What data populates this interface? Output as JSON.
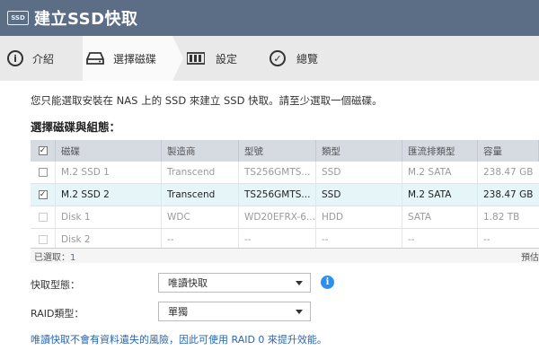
{
  "window": {
    "title": "建立SSD快取",
    "icon_text": "SSD",
    "icon": "ssd-icon"
  },
  "steps": [
    {
      "label": "介紹",
      "icon": "info-circle-icon",
      "active": false
    },
    {
      "label": "選擇磁碟",
      "icon": "disk-drive-icon",
      "active": true
    },
    {
      "label": "設定",
      "icon": "settings-bars-icon",
      "active": false
    },
    {
      "label": "總覽",
      "icon": "check-circle-icon",
      "active": false
    }
  ],
  "description": "您只能選取安裝在 NAS 上的 SSD 來建立 SSD 快取。請至少選取一個磁碟。",
  "section_title": "選擇磁碟與組態：",
  "table": {
    "columns": [
      "磁碟",
      "製造商",
      "型號",
      "類型",
      "匯流排類型",
      "容量"
    ],
    "rows": [
      {
        "checked": false,
        "enabled": true,
        "cells": [
          "M.2 SSD 1",
          "Transcend",
          "TS256GMTS...",
          "SSD",
          "M.2 SATA",
          "238.47 GB"
        ]
      },
      {
        "checked": true,
        "enabled": true,
        "cells": [
          "M.2 SSD 2",
          "Transcend",
          "TS256GMTS...",
          "SSD",
          "M.2 SATA",
          "238.47 GB"
        ]
      },
      {
        "checked": false,
        "enabled": false,
        "cells": [
          "Disk 1",
          "WDC",
          "WD20EFRX-6...",
          "HDD",
          "SATA",
          "1.82 TB"
        ]
      },
      {
        "checked": false,
        "enabled": false,
        "cells": [
          "Disk 2",
          "--",
          "--",
          "--",
          "--",
          "--"
        ]
      }
    ]
  },
  "footer": {
    "selected_label": "已選取：",
    "selected_count": "1",
    "preview_label": "預估"
  },
  "cache_mode": {
    "label": "快取型態：",
    "value": "唯讀快取"
  },
  "raid_type": {
    "label": "RAID類型：",
    "value": "單獨"
  },
  "note": "唯讀快取不會有資料遺失的風險，因此可使用 RAID 0 來提升效能。",
  "colors": {
    "titlebar": "#5b6e86",
    "selected_row": "#e6f5f8",
    "accent": "#2d8ff0"
  }
}
